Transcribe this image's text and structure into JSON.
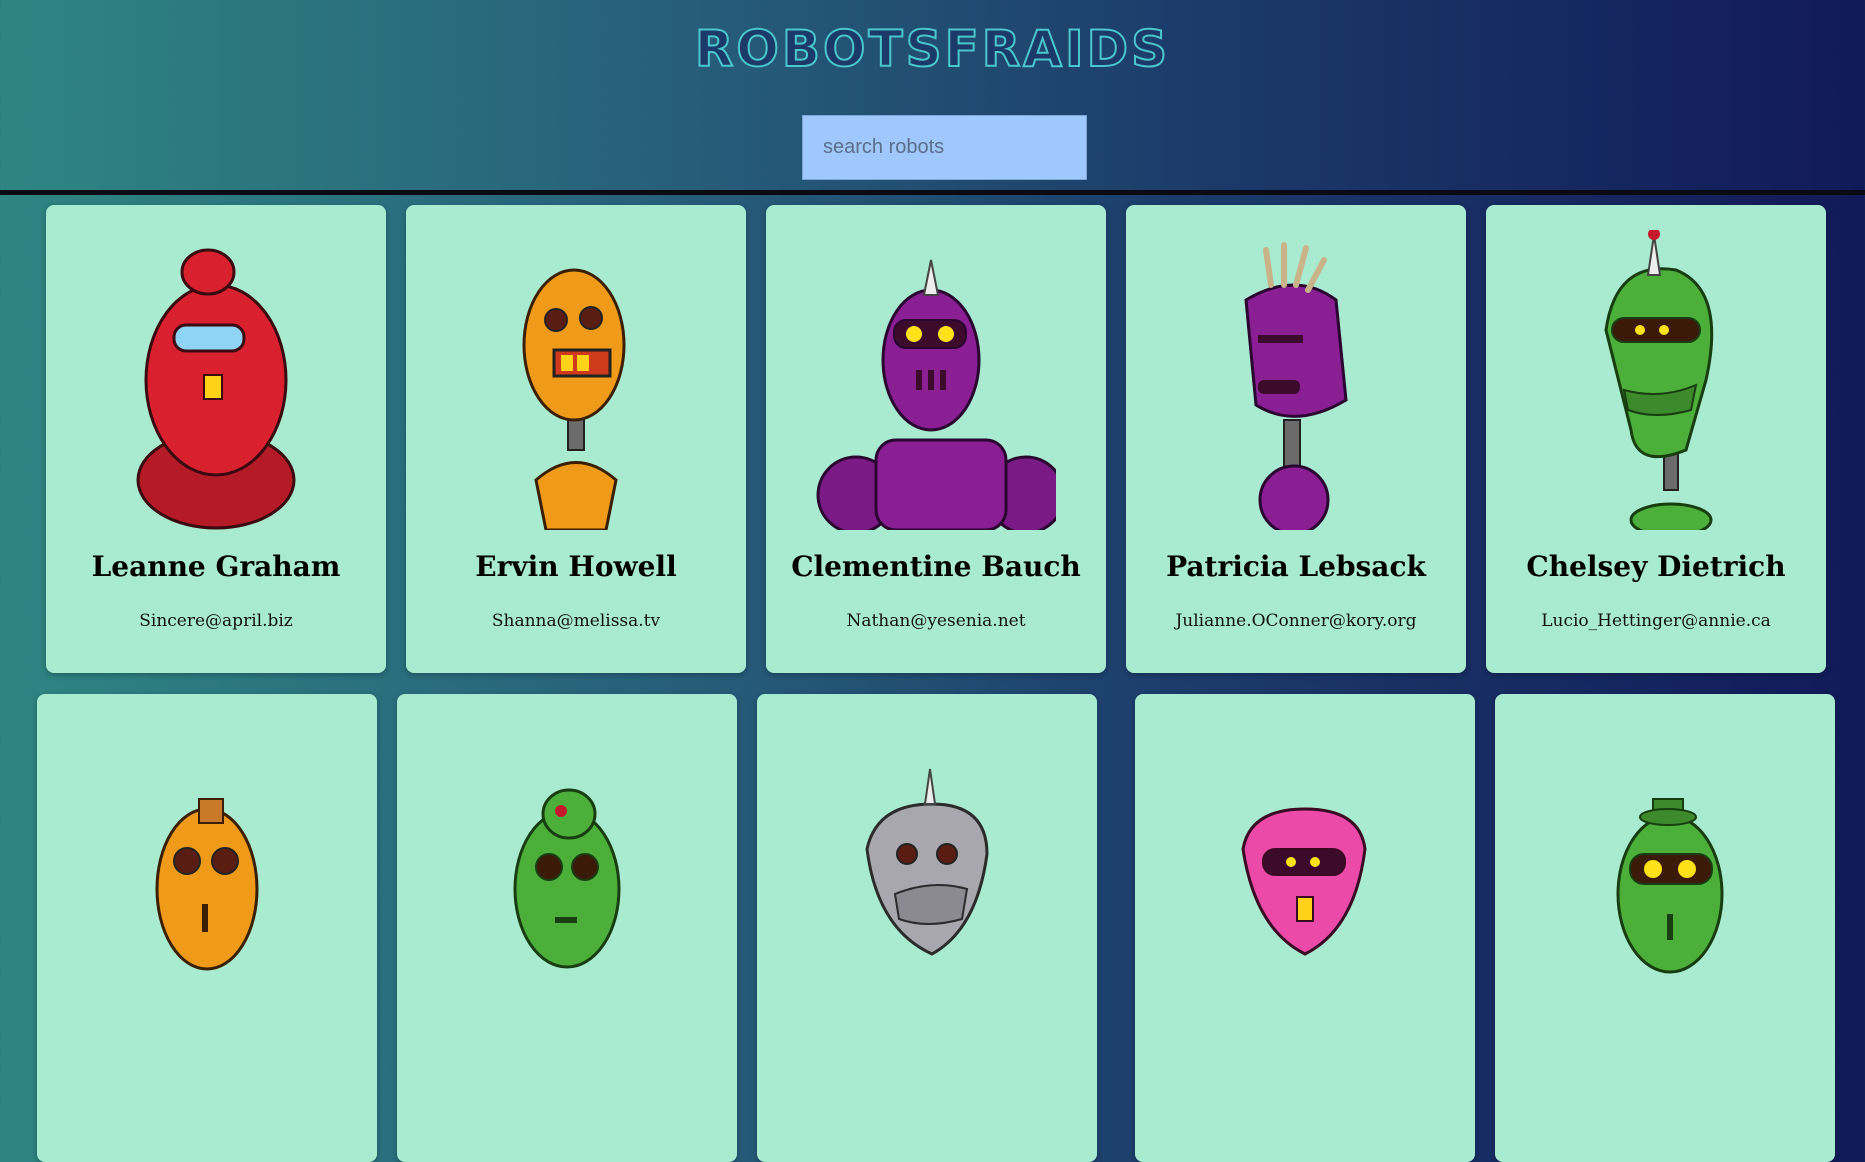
{
  "app": {
    "title": "ROBOTSFRAIDS"
  },
  "search": {
    "placeholder": "search robots",
    "value": ""
  },
  "robots": [
    {
      "name": "Leanne Graham",
      "email": "Sincere@april.biz",
      "color": "#d8202f"
    },
    {
      "name": "Ervin Howell",
      "email": "Shanna@melissa.tv",
      "color": "#f09a1a"
    },
    {
      "name": "Clementine Bauch",
      "email": "Nathan@yesenia.net",
      "color": "#8a1f94"
    },
    {
      "name": "Patricia Lebsack",
      "email": "Julianne.OConner@kory.org",
      "color": "#8a1f94"
    },
    {
      "name": "Chelsey Dietrich",
      "email": "Lucio_Hettinger@annie.ca",
      "color": "#4caf3a"
    },
    {
      "color": "#f09a1a"
    },
    {
      "color": "#4caf3a"
    },
    {
      "color": "#a7a7ad"
    },
    {
      "color": "#ec4aa9"
    },
    {
      "color": "#4caf3a"
    }
  ]
}
